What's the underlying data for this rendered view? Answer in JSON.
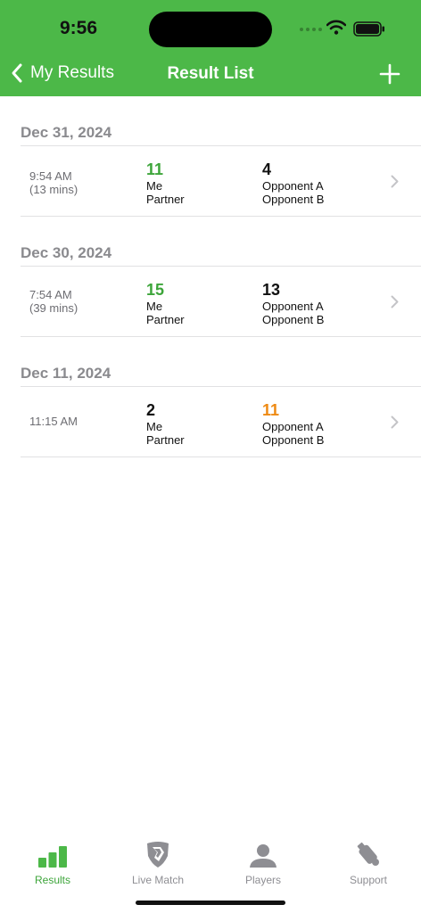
{
  "status": {
    "time": "9:56"
  },
  "nav": {
    "back_label": "My Results",
    "title": "Result List"
  },
  "sections": [
    {
      "date": "Dec 31, 2024",
      "results": [
        {
          "time": "9:54 AM",
          "duration": "(13 mins)",
          "team_score": "11",
          "team_players": [
            "Me",
            "Partner"
          ],
          "opp_score": "4",
          "opp_players": [
            "Opponent A",
            "Opponent B"
          ]
        }
      ]
    },
    {
      "date": "Dec 30, 2024",
      "results": [
        {
          "time": "7:54 AM",
          "duration": "(39 mins)",
          "team_score": "15",
          "team_players": [
            "Me",
            "Partner"
          ],
          "opp_score": "13",
          "opp_players": [
            "Opponent A",
            "Opponent B"
          ]
        }
      ]
    },
    {
      "date": "Dec 11, 2024",
      "results": [
        {
          "time": "11:15 AM",
          "duration": "",
          "team_score": "2",
          "team_players": [
            "Me",
            "Partner"
          ],
          "opp_score": "11",
          "opp_players": [
            "Opponent A",
            "Opponent B"
          ]
        }
      ]
    }
  ],
  "colors": {
    "brand": "#4cb848",
    "win": "#3da53a",
    "opponent_win": "#ee8a13"
  },
  "tabs": [
    {
      "label": "Results",
      "icon": "bar-chart-icon",
      "active": true
    },
    {
      "label": "Live Match",
      "icon": "shield-icon",
      "active": false
    },
    {
      "label": "Players",
      "icon": "person-icon",
      "active": false
    },
    {
      "label": "Support",
      "icon": "bottle-icon",
      "active": false
    }
  ]
}
